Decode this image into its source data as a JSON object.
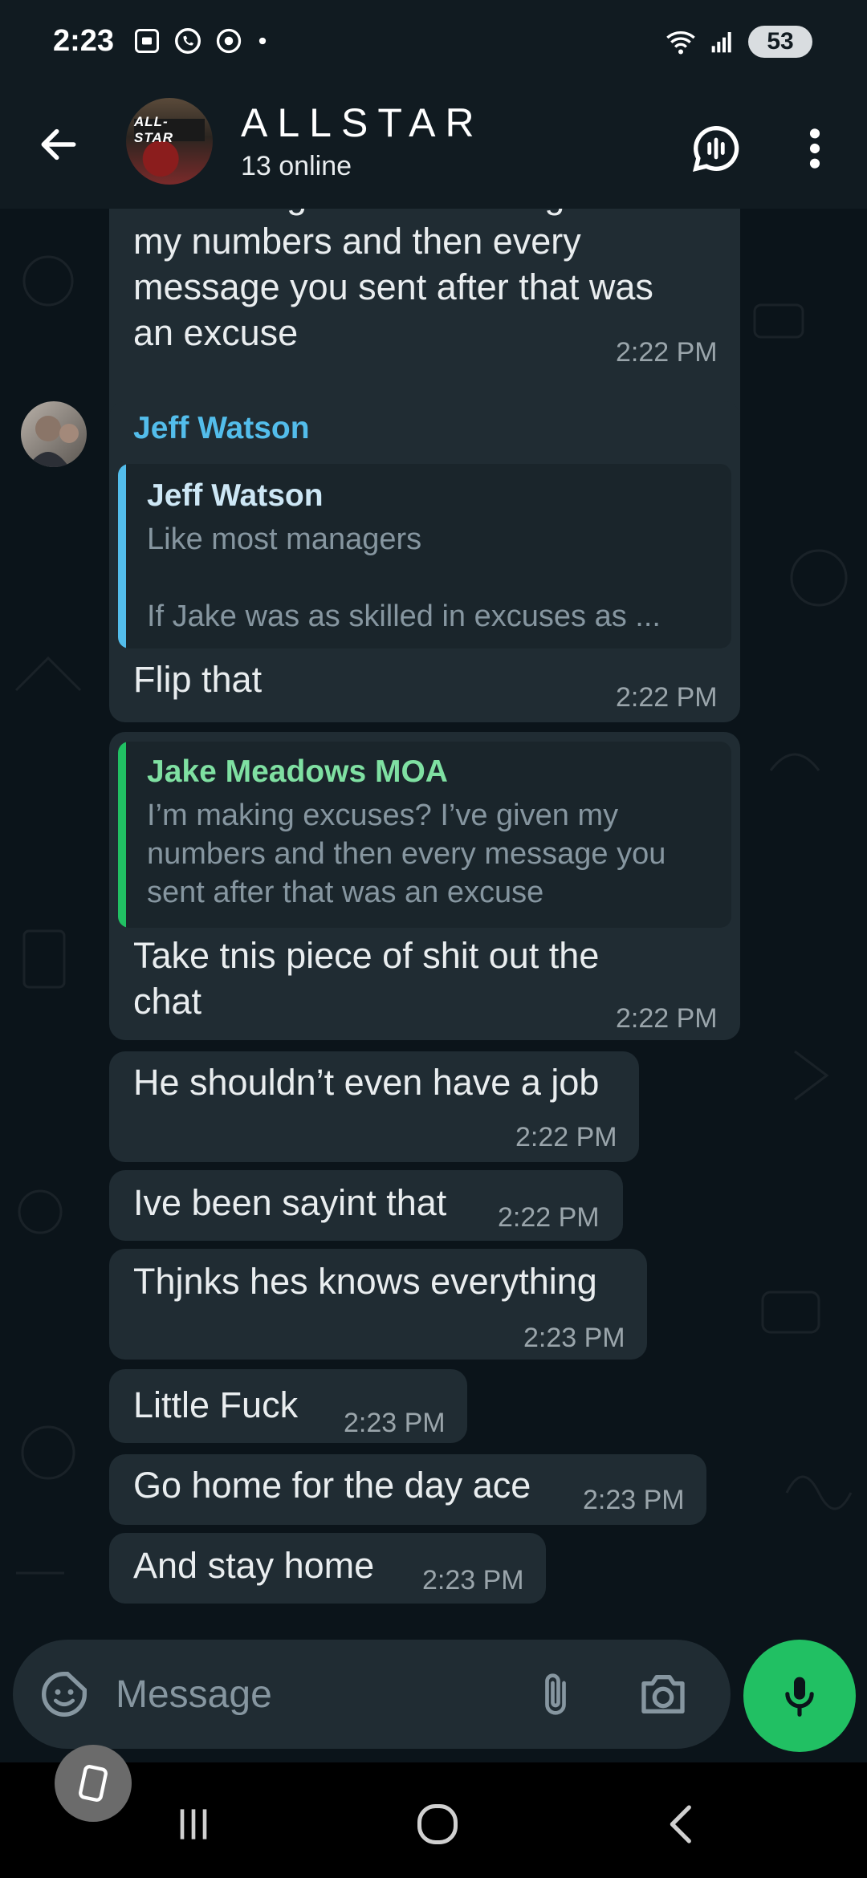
{
  "status_bar": {
    "time": "2:23",
    "battery": "53"
  },
  "header": {
    "group_name": "ALLSTAR",
    "subtitle": "13 online",
    "avatar_sign": "ALL-STAR"
  },
  "messages": [
    {
      "text_lines": [
        "I'm making excuses? I've given",
        "my numbers and then every",
        "message you sent after that was",
        "an excuse"
      ],
      "time": "2:22 PM"
    },
    {
      "sender": "Jeff Watson",
      "quote": {
        "name": "Jeff Watson",
        "lines": [
          "Like most managers",
          "",
          "If Jake was as skilled in excuses as ..."
        ]
      },
      "text": "Flip that",
      "time": "2:22 PM"
    },
    {
      "quote": {
        "name": "Jake Meadows MOA",
        "lines": [
          "I’m making excuses? I’ve given my",
          "numbers and then every message you",
          "sent after that was an excuse"
        ]
      },
      "text_lines": [
        "Take tnis piece of shit out the",
        "chat"
      ],
      "time": "2:22 PM"
    },
    {
      "text": "He shouldn’t even have a job",
      "time": "2:22 PM"
    },
    {
      "text": "Ive been sayint that",
      "time": "2:22 PM"
    },
    {
      "text": "Thjnks hes knows everything",
      "time": "2:23 PM"
    },
    {
      "text": "Little Fuck",
      "time": "2:23 PM"
    },
    {
      "text": "Go home for the day ace",
      "time": "2:23 PM"
    },
    {
      "text": "And stay home",
      "time": "2:23 PM"
    }
  ],
  "composer": {
    "placeholder": "Message"
  },
  "colors": {
    "accent_green": "#21c063",
    "sender_name": "#53bdeb",
    "quote_blue_bar": "#53bdeb",
    "quote_green_name": "#7fe0a2",
    "quote_green_bar": "#21c063"
  }
}
